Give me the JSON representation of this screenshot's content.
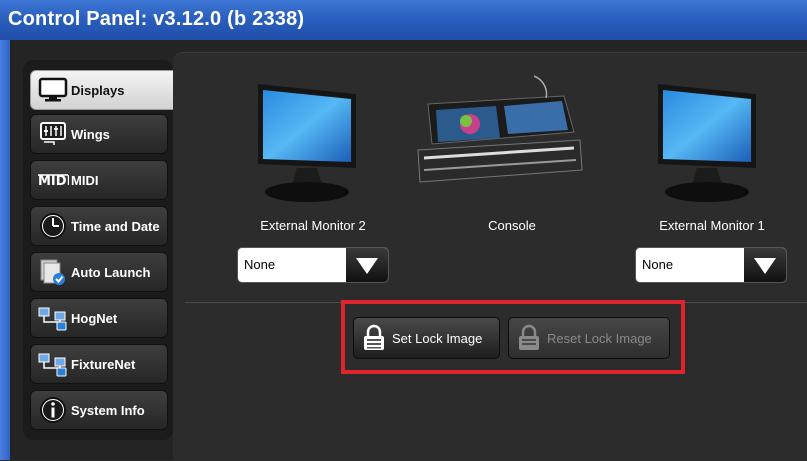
{
  "window": {
    "title": "Control Panel: v3.12.0 (b 2338)"
  },
  "tabs": [
    {
      "label": "Displays",
      "icon": "monitor-icon",
      "active": true
    },
    {
      "label": "Wings",
      "icon": "wing-faders-icon",
      "active": false
    },
    {
      "label": "MIDI",
      "icon": "midi-icon",
      "active": false
    },
    {
      "label": "Time and Date",
      "icon": "clock-icon",
      "active": false
    },
    {
      "label": "Auto Launch",
      "icon": "auto-launch-icon",
      "active": false
    },
    {
      "label": "HogNet",
      "icon": "network-icon",
      "active": false
    },
    {
      "label": "FixtureNet",
      "icon": "network-icon",
      "active": false
    },
    {
      "label": "System Info",
      "icon": "info-icon",
      "active": false
    }
  ],
  "displays": {
    "left_monitor": {
      "label": "External Monitor 2",
      "selected": "None"
    },
    "console": {
      "label": "Console"
    },
    "right_monitor": {
      "label": "External Monitor 1",
      "selected": "None"
    }
  },
  "lock": {
    "set_label": "Set Lock Image",
    "reset_label": "Reset Lock Image",
    "reset_enabled": false
  },
  "colors": {
    "highlight": "#e0242e",
    "titlebar": "#2a5fbf"
  }
}
